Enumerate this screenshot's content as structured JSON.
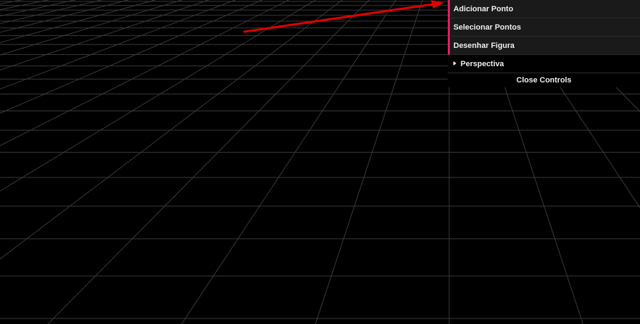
{
  "gui": {
    "items": [
      {
        "label": "Adicionar Ponto"
      },
      {
        "label": "Selecionar Pontos"
      },
      {
        "label": "Desenhar Figura"
      }
    ],
    "folder": {
      "label": "Perspectiva",
      "collapsed": true
    },
    "close_label": "Close Controls",
    "accent_color": "#e61d5f"
  },
  "scene": {
    "background_color": "#000000",
    "grid_color": "#3a3a3a",
    "annotation_arrow_color": "#e00000"
  }
}
